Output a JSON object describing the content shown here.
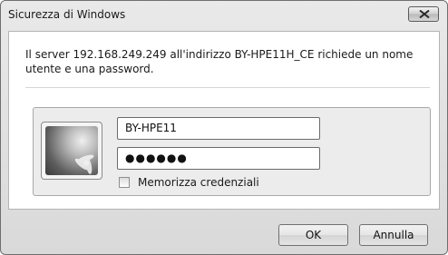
{
  "window": {
    "title": "Sicurezza di Windows"
  },
  "dialog": {
    "message": "Il server 192.168.249.249 all'indirizzo BY-HPE11H_CE richiede un nome utente e una password.",
    "username_value": "BY-HPE11",
    "password_value": "●●●●●●",
    "remember_label": "Memorizza credenziali",
    "remember_checked": false
  },
  "buttons": {
    "ok_label": "OK",
    "cancel_label": "Annulla"
  },
  "icons": {
    "close": "close-icon",
    "avatar": "user-avatar"
  }
}
